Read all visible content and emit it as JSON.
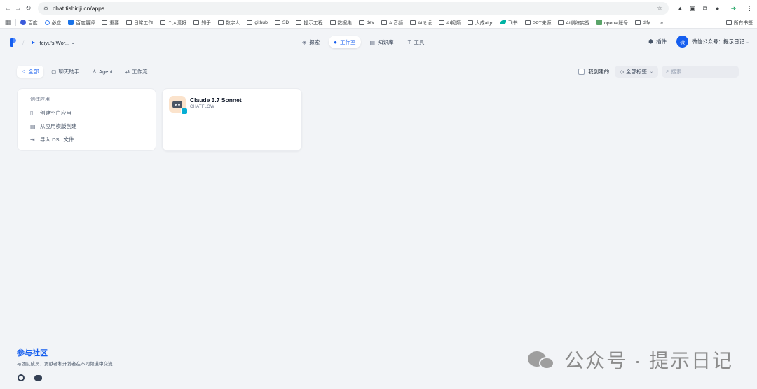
{
  "browser": {
    "url": "chat.tishiriji.cn/apps",
    "bookmarks": [
      "百度",
      "必应",
      "百度翻译",
      "重要",
      "日常工作",
      "个人爱好",
      "知乎",
      "数字人",
      "github",
      "SD",
      "提示工程",
      "数据集",
      "dev",
      "AI音频",
      "AI论坛",
      "AI视频",
      "大成aigc",
      "飞书",
      "PPT来源",
      "AI训练实战",
      "openai账号",
      "dify"
    ],
    "more": "»",
    "all_bookmarks": "所有书签"
  },
  "header": {
    "workspace_initial": "F",
    "workspace_name": "feiyu's Wor...",
    "nav": [
      {
        "label": "探索",
        "icon": "compass-icon"
      },
      {
        "label": "工作室",
        "icon": "robot-icon",
        "active": true
      },
      {
        "label": "知识库",
        "icon": "book-icon"
      },
      {
        "label": "工具",
        "icon": "hammer-icon"
      }
    ],
    "plugin_label": "插件",
    "avatar_text": "微",
    "user_name": "微信公众号：提示日记"
  },
  "filters": {
    "tabs": [
      {
        "label": "全部",
        "active": true
      },
      {
        "label": "聊天助手"
      },
      {
        "label": "Agent"
      },
      {
        "label": "工作流"
      }
    ],
    "my_created": "我创建的",
    "all_tags": "全部标签",
    "search_placeholder": "搜索"
  },
  "create_card": {
    "title": "创建应用",
    "items": [
      "创建空白应用",
      "从应用模版创建",
      "导入 DSL 文件"
    ]
  },
  "apps": [
    {
      "name": "Claude 3.7 Sonnet",
      "type": "CHATFLOW"
    }
  ],
  "footer": {
    "title": "参与社区",
    "subtitle": "与团队成员、贡献者和开发者在不同频道中交流"
  },
  "watermark": "公众号 · 提示日记"
}
